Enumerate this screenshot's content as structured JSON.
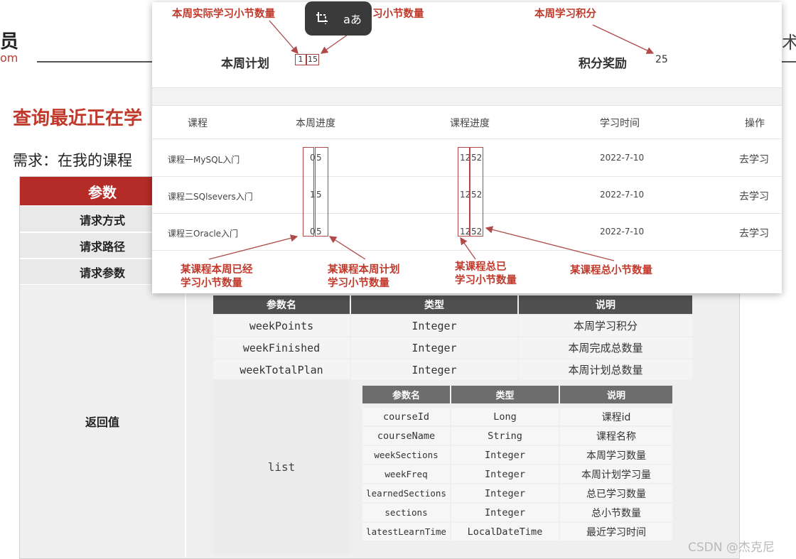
{
  "background": {
    "logo_char": "员",
    "logo_sub": "om",
    "right_char": "术",
    "heading": "查询最近正在学",
    "requirement": "需求：在我的课程"
  },
  "params": {
    "header": "参数",
    "rows": [
      "请求方式",
      "请求路径",
      "请求参数"
    ],
    "return_label": "返回值",
    "table_headers": [
      "参数名",
      "类型",
      "说明"
    ],
    "fields": [
      {
        "name": "weekPoints",
        "type": "Integer",
        "desc": "本周学习积分"
      },
      {
        "name": "weekFinished",
        "type": "Integer",
        "desc": "本周完成总数量"
      },
      {
        "name": "weekTotalPlan",
        "type": "Integer",
        "desc": "本周计划总数量"
      }
    ],
    "list_label": "list",
    "nested_headers": [
      "参数名",
      "类型",
      "说明"
    ],
    "nested_fields": [
      {
        "name": "courseId",
        "type": "Long",
        "desc": "课程id"
      },
      {
        "name": "courseName",
        "type": "String",
        "desc": "课程名称"
      },
      {
        "name": "weekSections",
        "type": "Integer",
        "desc": "本周学习数量"
      },
      {
        "name": "weekFreq",
        "type": "Integer",
        "desc": "本周计划学习量"
      },
      {
        "name": "learnedSections",
        "type": "Integer",
        "desc": "总已学习数量"
      },
      {
        "name": "sections",
        "type": "Integer",
        "desc": "总小节数量"
      },
      {
        "name": "latestLearnTime",
        "type": "LocalDateTime",
        "desc": "最近学习时间"
      }
    ]
  },
  "card": {
    "plan_title": "本周计划",
    "plan_done": "1",
    "plan_total": "15",
    "points_title": "积分奖励",
    "points_value": "25",
    "headers": [
      "课程",
      "本周进度",
      "课程进度",
      "学习时间",
      "操作"
    ],
    "rows": [
      {
        "course": "课程一MySQL入门",
        "week_done": "0",
        "week_total": "5",
        "done": "12",
        "total": "52",
        "time": "2022-7-10",
        "action": "去学习"
      },
      {
        "course": "课程二SQlsevers入门",
        "week_done": "1",
        "week_total": "5",
        "done": "12",
        "total": "52",
        "time": "2022-7-10",
        "action": "去学习"
      },
      {
        "course": "课程三Oracle入门",
        "week_done": "0",
        "week_total": "5",
        "done": "12",
        "total": "52",
        "time": "2022-7-10",
        "action": "去学习"
      }
    ],
    "annotations": {
      "actual_sections": "本周实际学习小节数量",
      "plan_sections": "习小节数量",
      "week_points": "本周学习积分",
      "course_week_learned": [
        "某课程本周已经",
        "学习小节数量"
      ],
      "course_week_plan": [
        "某课程本周计划",
        "学习小节数量"
      ],
      "course_total_learned": [
        "某课程总已",
        "学习小节数量"
      ],
      "course_total_sections": "某课程总小节数量"
    }
  },
  "toolbar": {
    "icons": [
      "crop-icon",
      "translate-icon"
    ],
    "translate_glyph": "aあ"
  },
  "watermark": "CSDN @杰克尼",
  "colors": {
    "accent": "#b52b27",
    "annotation": "#c0392b",
    "table_header": "#505050"
  }
}
